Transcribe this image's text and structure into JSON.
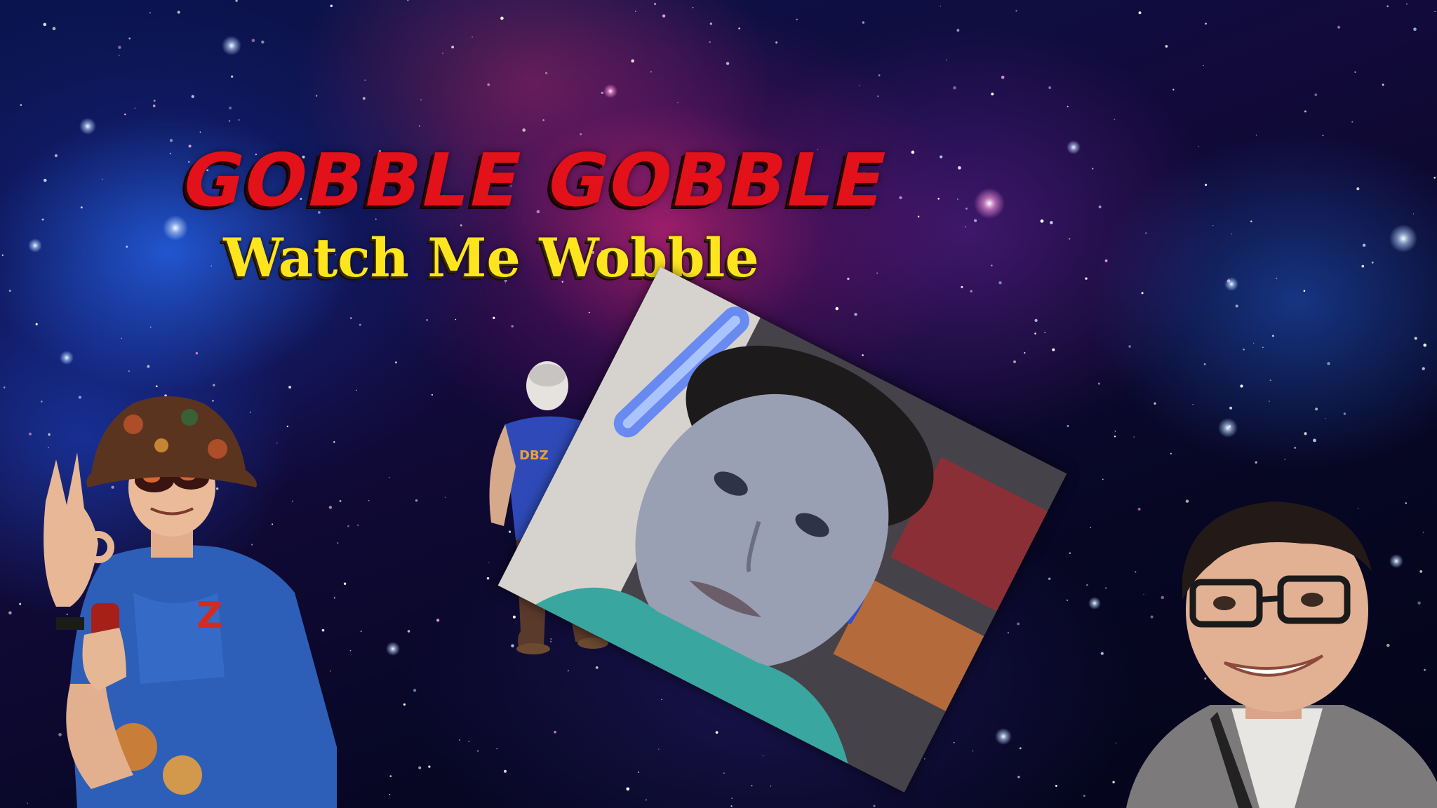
{
  "thumbnail": {
    "title_line_1": "GOBBLE GOBBLE",
    "title_line_2": "Watch Me Wobble"
  },
  "colors": {
    "title_line_1": "#e3111a",
    "title_line_2": "#ffe51e",
    "space_blue": "#2a6bff",
    "space_magenta": "#e0288a"
  },
  "people": [
    {
      "name": "person-bucket-hat",
      "description_icon": "person-ok-hand-icon"
    },
    {
      "name": "person-lightsaber",
      "description_icon": "person-lightsaber-icon"
    },
    {
      "name": "person-closeup",
      "description_icon": "person-face-icon"
    },
    {
      "name": "person-glasses",
      "description_icon": "person-glasses-icon"
    }
  ]
}
